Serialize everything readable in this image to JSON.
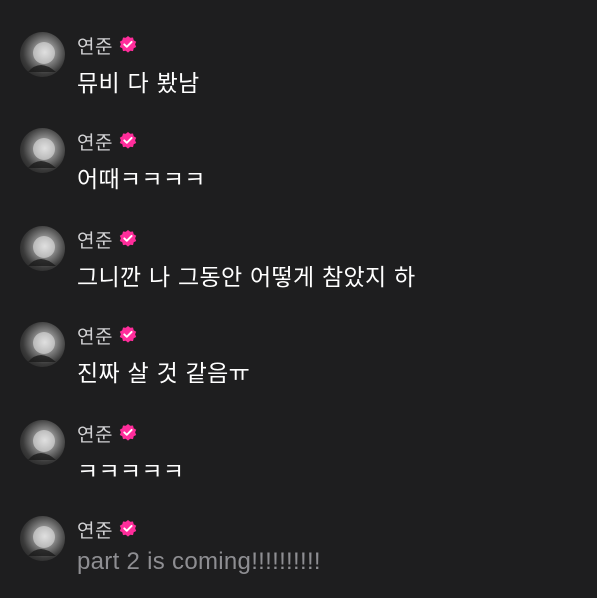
{
  "accent": "#ff2d9b",
  "messages": [
    {
      "author": "연준",
      "verified": true,
      "avatar_icon": "profile-photo",
      "text": "뮤비 다 봤남"
    },
    {
      "author": "연준",
      "verified": true,
      "avatar_icon": "profile-photo",
      "text": "어때ㅋㅋㅋㅋ"
    },
    {
      "author": "연준",
      "verified": true,
      "avatar_icon": "profile-photo",
      "text": "그니깐 나 그동안 어떻게 참았지 하"
    },
    {
      "author": "연준",
      "verified": true,
      "avatar_icon": "profile-photo",
      "text": "진짜 살 것 같음ㅠ"
    },
    {
      "author": "연준",
      "verified": true,
      "avatar_icon": "profile-photo",
      "text": "ㅋㅋㅋㅋㅋ"
    },
    {
      "author": "연준",
      "verified": true,
      "avatar_icon": "profile-photo",
      "text": "part 2 is coming!!!!!!!!!!",
      "dimmed": true
    }
  ]
}
